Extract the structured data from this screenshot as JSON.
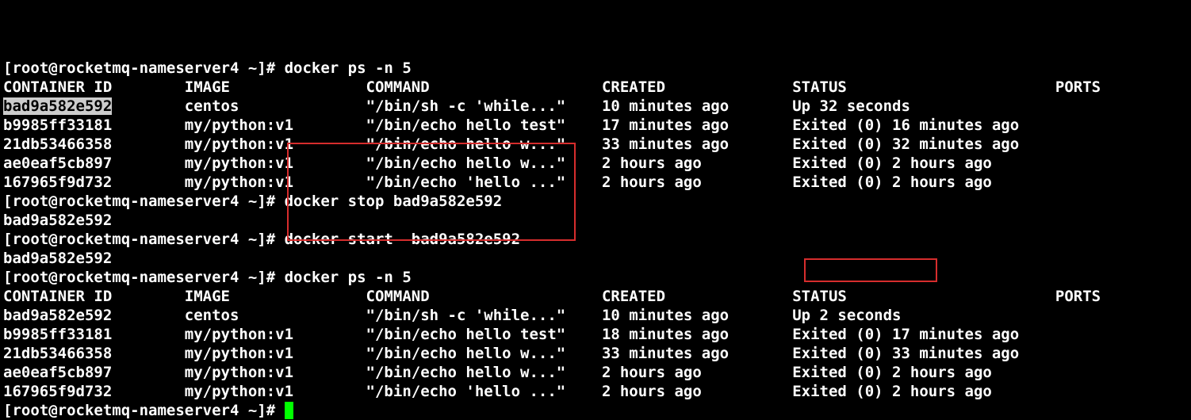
{
  "prompt": "[root@rocketmq-nameserver4 ~]# ",
  "columns": {
    "id": "CONTAINER ID",
    "image": "IMAGE",
    "command": "COMMAND",
    "created": "CREATED",
    "status": "STATUS",
    "ports": "PORTS"
  },
  "commands": {
    "ps_first": "docker ps -n 5",
    "stop": "docker stop bad9a582e592",
    "start": "docker start  bad9a582e592",
    "ps_second": "docker ps -n 5"
  },
  "stop_output": "bad9a582e592",
  "start_output": "bad9a582e592",
  "selected_id": "bad9a582e592",
  "ps1": [
    {
      "id": "bad9a582e592",
      "image": "centos",
      "command": "\"/bin/sh -c 'while...\"",
      "created": "10 minutes ago",
      "status": "Up 32 seconds",
      "ports": ""
    },
    {
      "id": "b9985ff33181",
      "image": "my/python:v1",
      "command": "\"/bin/echo hello test\"",
      "created": "17 minutes ago",
      "status": "Exited (0) 16 minutes ago",
      "ports": ""
    },
    {
      "id": "21db53466358",
      "image": "my/python:v1",
      "command": "\"/bin/echo hello w...\"",
      "created": "33 minutes ago",
      "status": "Exited (0) 32 minutes ago",
      "ports": ""
    },
    {
      "id": "ae0eaf5cb897",
      "image": "my/python:v1",
      "command": "\"/bin/echo hello w...\"",
      "created": "2 hours ago",
      "status": "Exited (0) 2 hours ago",
      "ports": ""
    },
    {
      "id": "167965f9d732",
      "image": "my/python:v1",
      "command": "\"/bin/echo 'hello ...\"",
      "created": "2 hours ago",
      "status": "Exited (0) 2 hours ago",
      "ports": ""
    }
  ],
  "ps2": [
    {
      "id": "bad9a582e592",
      "image": "centos",
      "command": "\"/bin/sh -c 'while...\"",
      "created": "10 minutes ago",
      "status": "Up 2 seconds",
      "ports": ""
    },
    {
      "id": "b9985ff33181",
      "image": "my/python:v1",
      "command": "\"/bin/echo hello test\"",
      "created": "18 minutes ago",
      "status": "Exited (0) 17 minutes ago",
      "ports": ""
    },
    {
      "id": "21db53466358",
      "image": "my/python:v1",
      "command": "\"/bin/echo hello w...\"",
      "created": "33 minutes ago",
      "status": "Exited (0) 33 minutes ago",
      "ports": ""
    },
    {
      "id": "ae0eaf5cb897",
      "image": "my/python:v1",
      "command": "\"/bin/echo hello w...\"",
      "created": "2 hours ago",
      "status": "Exited (0) 2 hours ago",
      "ports": ""
    },
    {
      "id": "167965f9d732",
      "image": "my/python:v1",
      "command": "\"/bin/echo 'hello ...\"",
      "created": "2 hours ago",
      "status": "Exited (0) 2 hours ago",
      "ports": ""
    }
  ],
  "layout": {
    "w_id": 20,
    "w_image": 20,
    "w_command": 26,
    "w_created": 21,
    "w_status": 29
  }
}
